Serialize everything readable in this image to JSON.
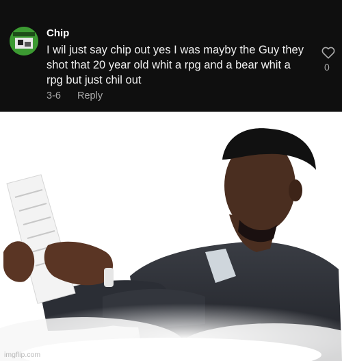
{
  "comment": {
    "author": "Chip",
    "text_lines": [
      "I wil just say chip out yes I was mayby the Guy they",
      "shot that 20 year old whit a rpg and a bear whit a",
      "rpg but just chil out"
    ],
    "date": "3-6",
    "reply_label": "Reply",
    "like_count": "0",
    "like_icon": "heart-outline-icon"
  },
  "meme": {
    "description_icon": "man-reading-paper-image"
  },
  "watermark": "imgflip.com",
  "colors": {
    "panel_bg": "#0f0f0f",
    "text_primary": "#f1f1f1",
    "text_secondary": "#aaaaaa"
  }
}
